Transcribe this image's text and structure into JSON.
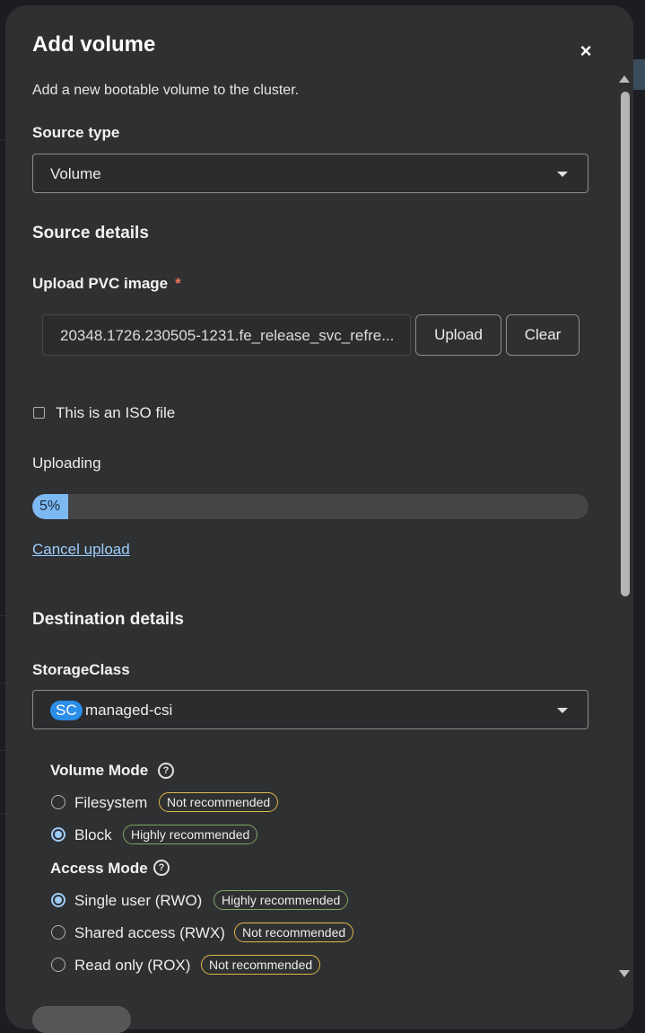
{
  "modal": {
    "title": "Add volume",
    "close_label": "×",
    "description": "Add a new bootable volume to the cluster."
  },
  "source_type": {
    "label": "Source type",
    "value": "Volume"
  },
  "source_details": {
    "heading": "Source details",
    "upload_label": "Upload PVC image",
    "required_marker": "*",
    "file_name": "20348.1726.230505-1231.fe_release_svc_refre...",
    "upload_button": "Upload",
    "clear_button": "Clear",
    "iso_checkbox_label": "This is an ISO file",
    "iso_checked": false,
    "uploading_label": "Uploading",
    "progress_percent": 5,
    "progress_text": "5%",
    "cancel_link": "Cancel upload"
  },
  "destination": {
    "heading": "Destination details",
    "storage_class_label": "StorageClass",
    "storage_class_badge": "SC",
    "storage_class_value": "managed-csi",
    "volume_mode": {
      "label": "Volume Mode",
      "help_icon": "?",
      "options": [
        {
          "label": "Filesystem",
          "badge": "Not recommended",
          "selected": false
        },
        {
          "label": "Block",
          "badge": "Highly recommended",
          "selected": true
        }
      ]
    },
    "access_mode": {
      "label": "Access Mode",
      "help_icon": "?",
      "options": [
        {
          "label": "Single user (RWO)",
          "badge": "Highly recommended",
          "selected": true
        },
        {
          "label": "Shared access (RWX)",
          "badge": "Not recommended",
          "selected": false
        },
        {
          "label": "Read only (ROX)",
          "badge": "Not recommended",
          "selected": false
        }
      ]
    }
  },
  "colors": {
    "modal_bg": "#2f3032",
    "accent_blue": "#9ccdfa",
    "progress_fill": "#7cb8f2",
    "warn_border": "#e0b84a",
    "good_border": "#7ca862",
    "required": "#f0775a"
  }
}
